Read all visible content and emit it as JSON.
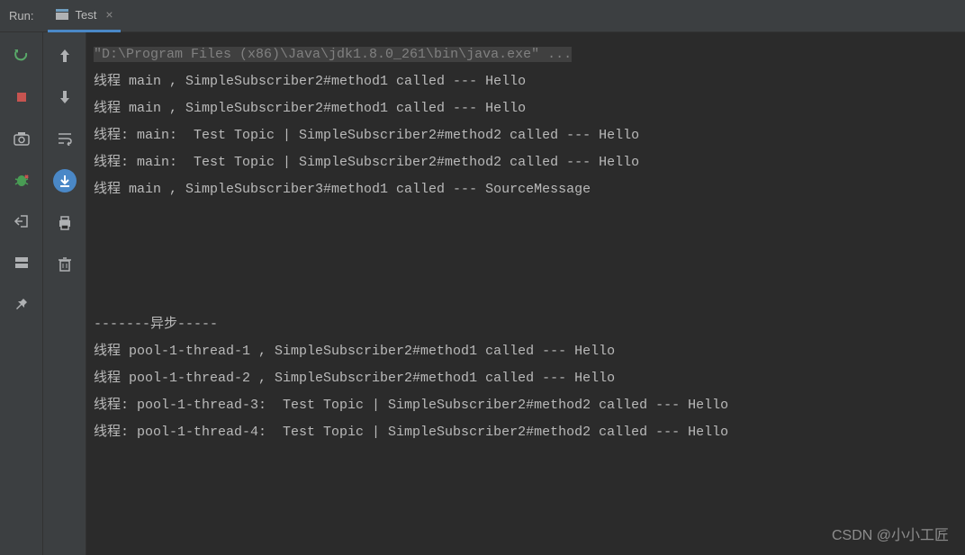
{
  "header": {
    "run_label": "Run:",
    "tab_label": "Test",
    "tab_close": "×"
  },
  "console": {
    "cmd": "\"D:\\Program Files (x86)\\Java\\jdk1.8.0_261\\bin\\java.exe\" ...",
    "lines": [
      "线程 main , SimpleSubscriber2#method1 called --- Hello",
      "线程 main , SimpleSubscriber2#method1 called --- Hello",
      "线程: main:  Test Topic | SimpleSubscriber2#method2 called --- Hello",
      "线程: main:  Test Topic | SimpleSubscriber2#method2 called --- Hello",
      "线程 main , SimpleSubscriber3#method1 called --- SourceMessage",
      "",
      "",
      "",
      "",
      "-------异步-----",
      "线程 pool-1-thread-1 , SimpleSubscriber2#method1 called --- Hello",
      "线程 pool-1-thread-2 , SimpleSubscriber2#method1 called --- Hello",
      "线程: pool-1-thread-3:  Test Topic | SimpleSubscriber2#method2 called --- Hello",
      "线程: pool-1-thread-4:  Test Topic | SimpleSubscriber2#method2 called --- Hello"
    ]
  },
  "watermark": "CSDN @小小工匠",
  "colors": {
    "bg": "#2b2b2b",
    "panel": "#3c3f41",
    "accent": "#4a88c7",
    "text": "#bababa",
    "rerun": "#59a869",
    "stop": "#c75450",
    "bug": "#499c54"
  }
}
